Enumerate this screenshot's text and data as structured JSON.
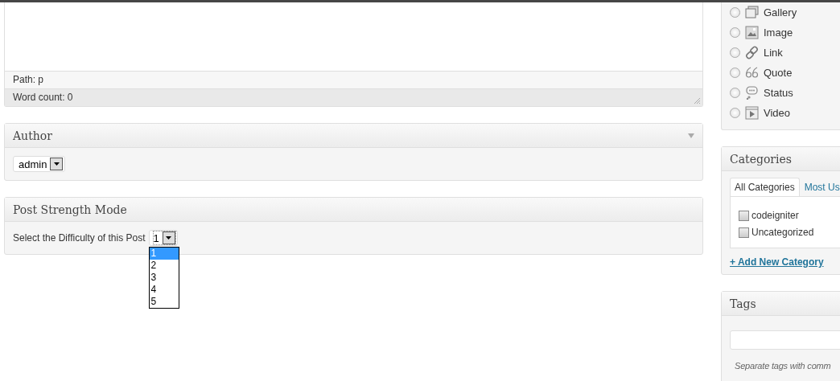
{
  "editor": {
    "path": "Path: p",
    "word_count": "Word count: 0"
  },
  "author": {
    "title": "Author",
    "value": "admin"
  },
  "post_strength": {
    "title": "Post Strength Mode",
    "label": "Select the Difficulty of this Post",
    "value": "1",
    "expanded": true,
    "options": [
      {
        "label": "1",
        "selected": true
      },
      {
        "label": "2",
        "selected": false
      },
      {
        "label": "3",
        "selected": false
      },
      {
        "label": "4",
        "selected": false
      },
      {
        "label": "5",
        "selected": false
      }
    ]
  },
  "formats": [
    {
      "kind": "gallery",
      "label": "Gallery",
      "selected": false
    },
    {
      "kind": "image",
      "label": "Image",
      "selected": false
    },
    {
      "kind": "link",
      "label": "Link",
      "selected": false
    },
    {
      "kind": "quote",
      "label": "Quote",
      "selected": false
    },
    {
      "kind": "status",
      "label": "Status",
      "selected": false
    },
    {
      "kind": "video",
      "label": "Video",
      "selected": false
    }
  ],
  "categories": {
    "title": "Categories",
    "tabs": [
      {
        "label": "All Categories",
        "selected": true
      },
      {
        "label": "Most Us",
        "selected": false
      }
    ],
    "items": [
      {
        "label": "codeigniter",
        "checked": false
      },
      {
        "label": "Uncategorized",
        "checked": false
      }
    ],
    "add_link": "+ Add New Category"
  },
  "tags": {
    "title": "Tags",
    "hint": "Separate tags with comm"
  }
}
